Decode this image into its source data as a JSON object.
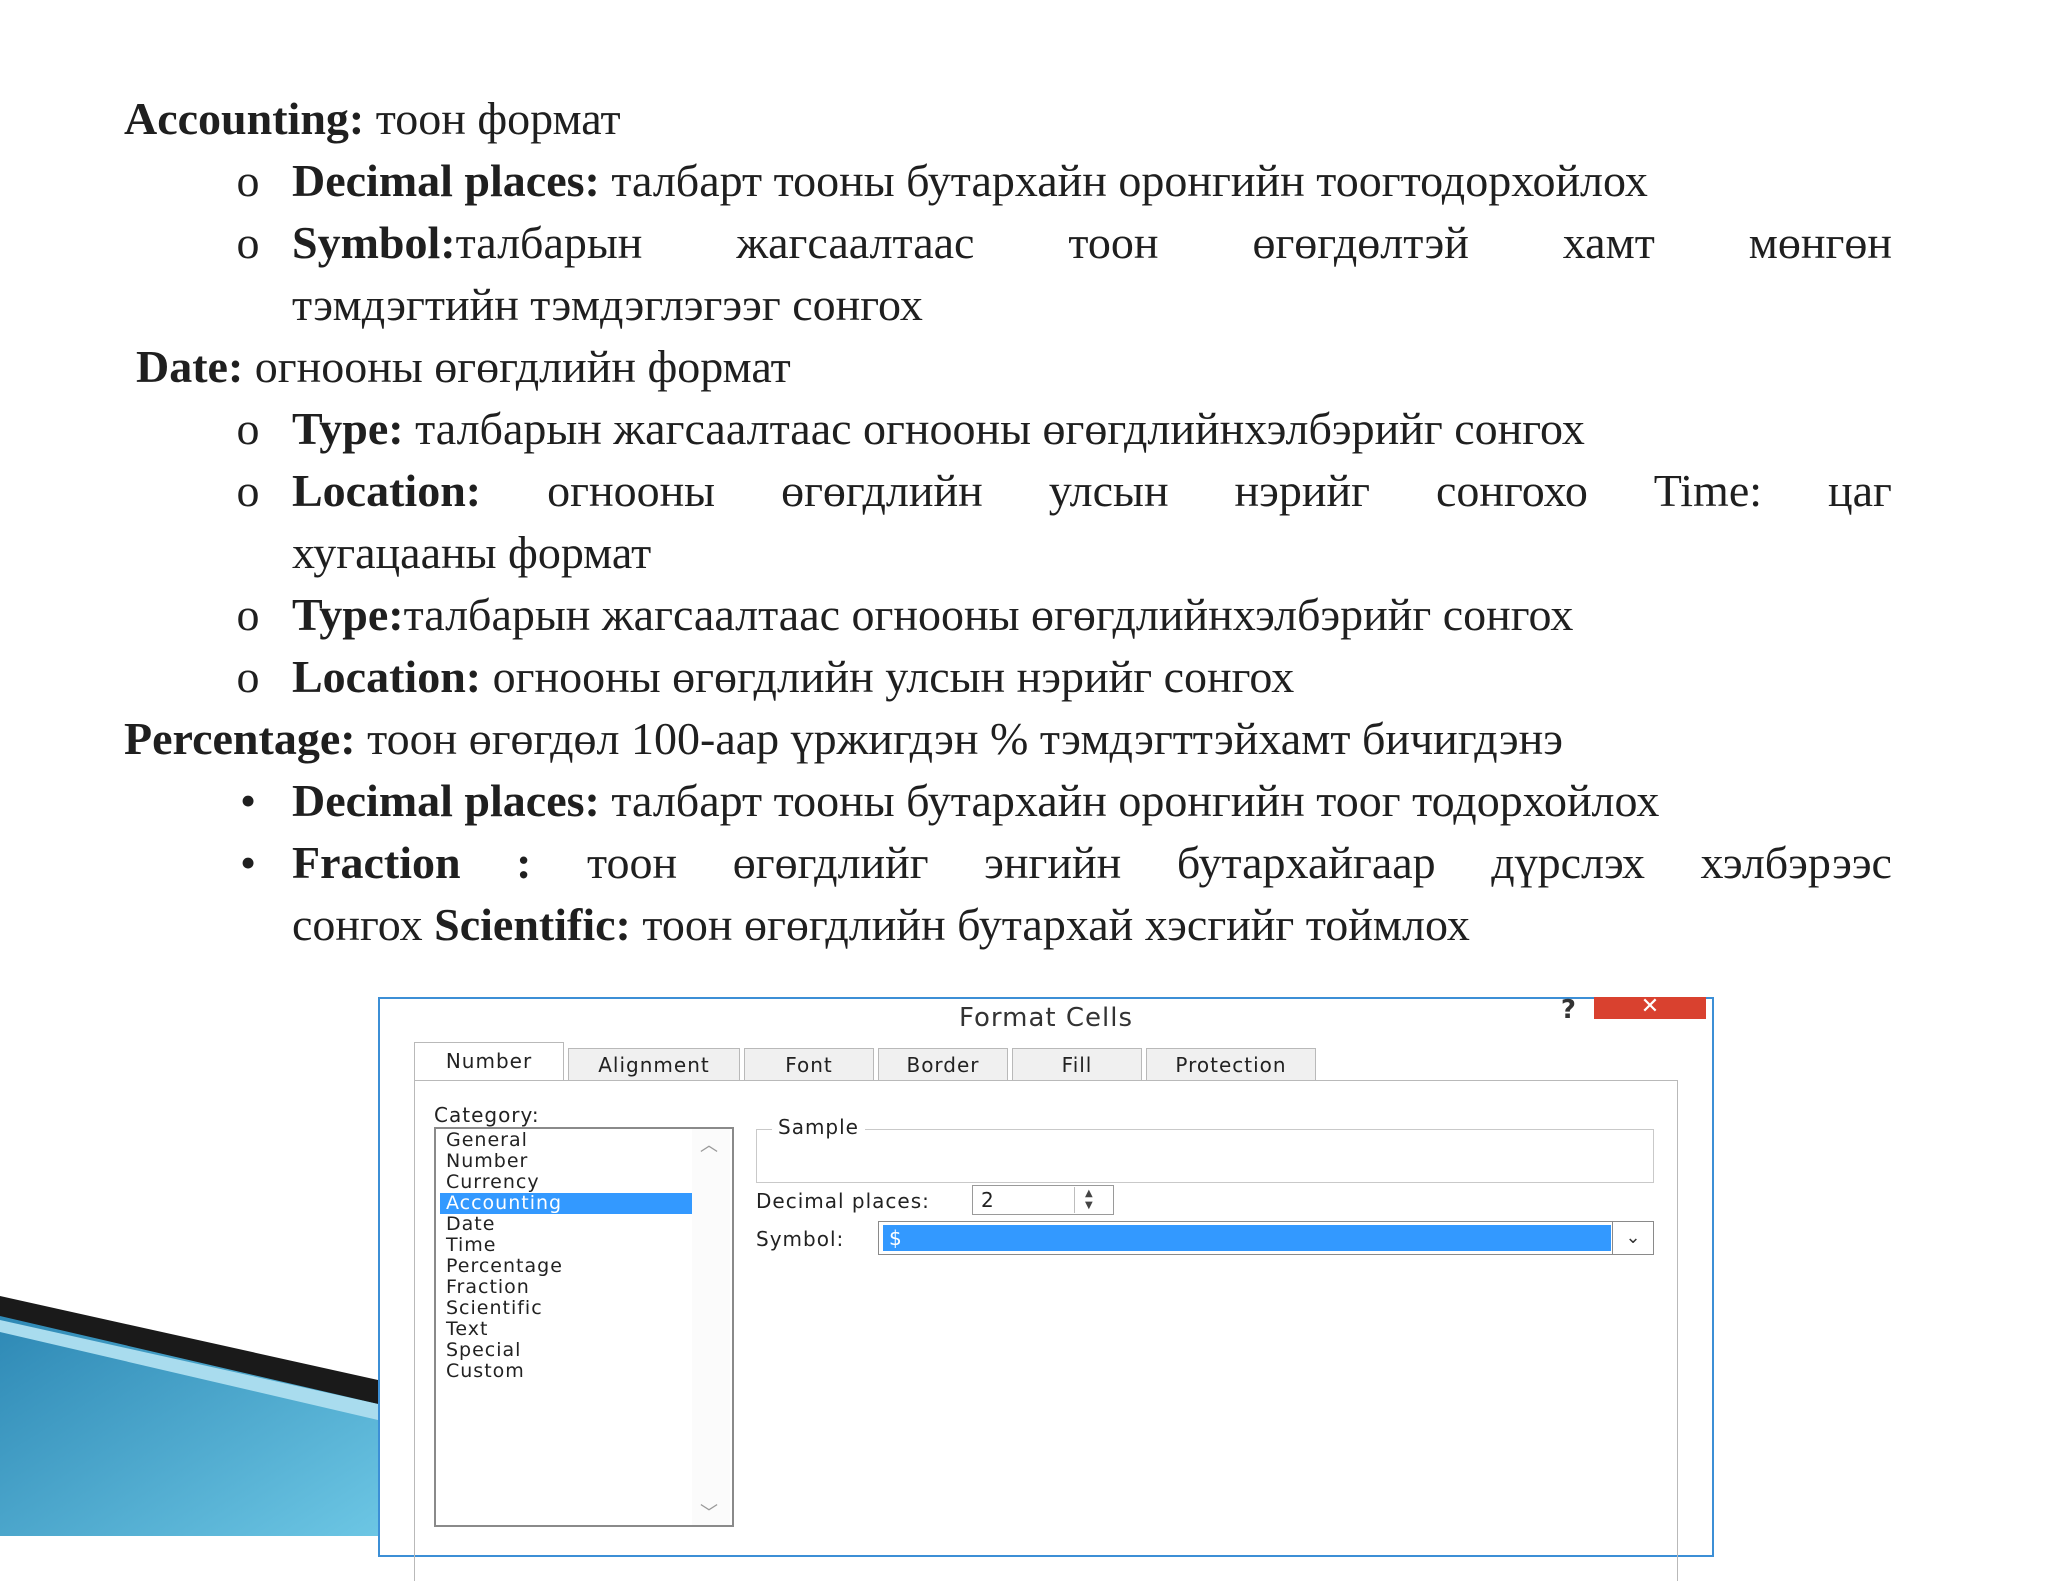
{
  "slide": {
    "accounting": {
      "term": "Accounting:",
      "desc": "тоон формат"
    },
    "acc_decimal": {
      "term": "Decimal places:",
      "desc": "талбарт тооны бутархайн оронгийн тоогтодорхойлох"
    },
    "acc_symbol": {
      "term": "Symbol:",
      "words": [
        "талбарын",
        "жагсаалтаас",
        "тоон",
        "өгөгдөлтэй",
        "хамт",
        "мөнгөн"
      ],
      "cont": "тэмдэгтийн тэмдэглэгээг сонгох"
    },
    "date": {
      "term": "Date:",
      "desc": "огнооны өгөгдлийн формат"
    },
    "date_type": {
      "term": "Type:",
      "desc": "талбарын жагсаалтаас огнооны өгөгдлийнхэлбэрийг сонгох"
    },
    "date_location": {
      "term": "Location:",
      "words": [
        "огнооны",
        "өгөгдлийн",
        "улсын",
        "нэрийг",
        "сонгохо",
        "Time:",
        "цаг"
      ],
      "cont": "хугацааны формат"
    },
    "time_type": {
      "term": "Type:",
      "desc": "талбарын жагсаалтаас огнооны өгөгдлийнхэлбэрийг сонгох"
    },
    "time_location": {
      "term": "Location:",
      "desc": "огнооны өгөгдлийн улсын нэрийг сонгох"
    },
    "percentage": {
      "term": "Percentage:",
      "desc": "тоон өгөгдөл 100-аар үржигдэн % тэмдэгттэйхамт бичигдэнэ"
    },
    "pct_decimal": {
      "term": "Decimal places:",
      "desc": "талбарт тооны бутархайн оронгийн тоог тодорхойлох"
    },
    "fraction": {
      "term": "Fraction",
      "words": [
        ":",
        "тоон",
        "өгөгдлийг",
        "энгийн",
        "бутархайгаар",
        "дүрслэх",
        "хэлбэрээс"
      ],
      "cont_start": "сонгох",
      "scientific_term": "Scientific:",
      "scientific_desc": "тоон өгөгдлийн бутархай хэсгийг тоймлох"
    },
    "circle_bullet": "o",
    "dot_bullet": "•"
  },
  "dialog": {
    "title": "Format Cells",
    "help": "?",
    "close": "✕",
    "tabs": [
      "Number",
      "Alignment",
      "Font",
      "Border",
      "Fill",
      "Protection"
    ],
    "category_label": "Category:",
    "categories": [
      "General",
      "Number",
      "Currency",
      "Accounting",
      "Date",
      "Time",
      "Percentage",
      "Fraction",
      "Scientific",
      "Text",
      "Special",
      "Custom"
    ],
    "selected_category": "Accounting",
    "sample_label": "Sample",
    "decimal_label": "Decimal places:",
    "decimal_value": "2",
    "symbol_label": "Symbol:",
    "symbol_value": "$"
  },
  "colors": {
    "accent_blue": "#3399ff",
    "title_border": "#3c8fd6",
    "close_red": "#d9412f"
  }
}
